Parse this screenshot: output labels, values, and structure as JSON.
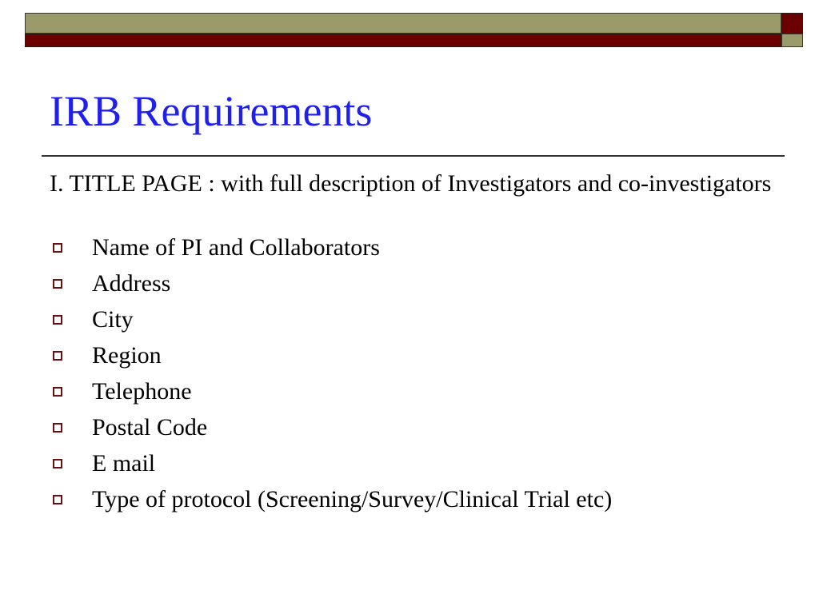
{
  "slide": {
    "title": "IRB Requirements",
    "intro": "I. TITLE PAGE : with full description of Investigators and co-investigators",
    "bullet_icon": "hollow-square-bullet",
    "items": [
      {
        "label": "Name of PI and Collaborators"
      },
      {
        "label": "Address"
      },
      {
        "label": "City"
      },
      {
        "label": "Region"
      },
      {
        "label": "Telephone"
      },
      {
        "label": "Postal Code"
      },
      {
        "label": "E mail"
      },
      {
        "label": "Type of protocol (Screening/Survey/Clinical Trial etc)"
      }
    ]
  },
  "theme": {
    "title_color": "#1f1fee",
    "olive": "#9a9a6a",
    "maroon": "#6b0000"
  }
}
